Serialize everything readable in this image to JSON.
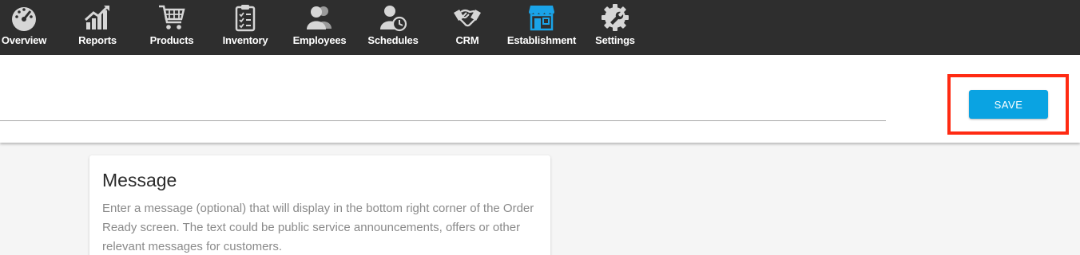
{
  "nav": {
    "items": [
      {
        "label": "Overview",
        "icon": "speedometer-icon"
      },
      {
        "label": "Reports",
        "icon": "chart-growth-icon"
      },
      {
        "label": "Products",
        "icon": "shopping-cart-icon"
      },
      {
        "label": "Inventory",
        "icon": "clipboard-checklist-icon"
      },
      {
        "label": "Employees",
        "icon": "people-icon"
      },
      {
        "label": "Schedules",
        "icon": "person-clock-icon"
      },
      {
        "label": "CRM",
        "icon": "handshake-icon"
      },
      {
        "label": "Establishment",
        "icon": "storefront-icon"
      },
      {
        "label": "Settings",
        "icon": "gear-wrench-icon"
      }
    ],
    "active_index": 7,
    "active_color": "#1aa3e8",
    "icon_color": "#d6d6d6"
  },
  "header": {
    "save_label": "SAVE",
    "save_color": "#0aa3e2",
    "highlight_color": "#ff2a12"
  },
  "card": {
    "title": "Message",
    "description": "Enter a message (optional) that will display in the bottom right corner of the Order Ready screen. The text could be public service announcements, offers or other relevant messages for customers."
  }
}
